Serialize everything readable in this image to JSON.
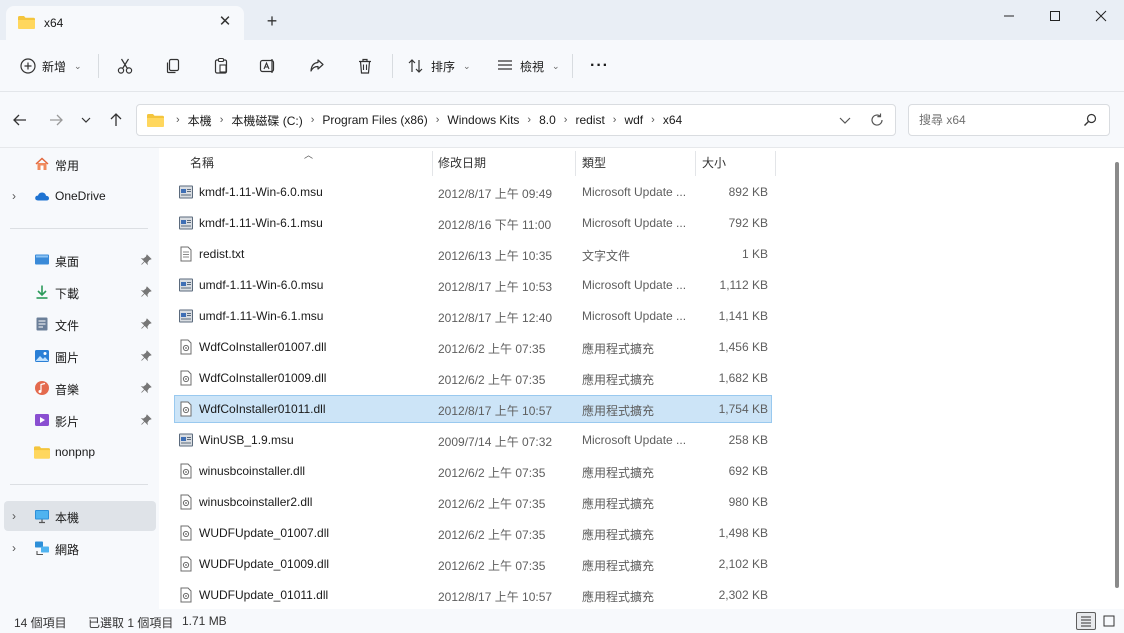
{
  "window": {
    "tab_title": "x64",
    "new_tab_symbol": "+",
    "close_tab_symbol": "✕"
  },
  "toolbar": {
    "new_label": "新增",
    "sort_label": "排序",
    "view_label": "檢視",
    "more_symbol": "···"
  },
  "breadcrumb": [
    "本機",
    "本機磁碟 (C:)",
    "Program Files (x86)",
    "Windows Kits",
    "8.0",
    "redist",
    "wdf",
    "x64"
  ],
  "search": {
    "placeholder": "搜尋 x64"
  },
  "sidebar": {
    "items": [
      {
        "label": "常用",
        "icon": "home-icon",
        "chevron": false,
        "pinned": false
      },
      {
        "label": "OneDrive",
        "icon": "cloud-icon",
        "chevron": true,
        "pinned": false
      },
      {
        "label": "桌面",
        "icon": "desktop-icon",
        "chevron": false,
        "pinned": true
      },
      {
        "label": "下載",
        "icon": "download-icon",
        "chevron": false,
        "pinned": true
      },
      {
        "label": "文件",
        "icon": "document-icon",
        "chevron": false,
        "pinned": true
      },
      {
        "label": "圖片",
        "icon": "picture-icon",
        "chevron": false,
        "pinned": true
      },
      {
        "label": "音樂",
        "icon": "music-icon",
        "chevron": false,
        "pinned": true
      },
      {
        "label": "影片",
        "icon": "video-icon",
        "chevron": false,
        "pinned": true
      },
      {
        "label": "nonpnp",
        "icon": "folder-icon",
        "chevron": false,
        "pinned": false
      },
      {
        "label": "本機",
        "icon": "computer-icon",
        "chevron": true,
        "pinned": false,
        "selected": true
      },
      {
        "label": "網路",
        "icon": "network-icon",
        "chevron": true,
        "pinned": false
      }
    ]
  },
  "columns": {
    "name": "名稱",
    "date": "修改日期",
    "type": "類型",
    "size": "大小"
  },
  "files": [
    {
      "name": "kmdf-1.11-Win-6.0.msu",
      "date": "2012/8/17 上午 09:49",
      "type": "Microsoft Update ...",
      "size": "892 KB",
      "icon": "msu-icon"
    },
    {
      "name": "kmdf-1.11-Win-6.1.msu",
      "date": "2012/8/16 下午 11:00",
      "type": "Microsoft Update ...",
      "size": "792 KB",
      "icon": "msu-icon"
    },
    {
      "name": "redist.txt",
      "date": "2012/6/13 上午 10:35",
      "type": "文字文件",
      "size": "1 KB",
      "icon": "text-file-icon"
    },
    {
      "name": "umdf-1.11-Win-6.0.msu",
      "date": "2012/8/17 上午 10:53",
      "type": "Microsoft Update ...",
      "size": "1,112 KB",
      "icon": "msu-icon"
    },
    {
      "name": "umdf-1.11-Win-6.1.msu",
      "date": "2012/8/17 上午 12:40",
      "type": "Microsoft Update ...",
      "size": "1,141 KB",
      "icon": "msu-icon"
    },
    {
      "name": "WdfCoInstaller01007.dll",
      "date": "2012/6/2 上午 07:35",
      "type": "應用程式擴充",
      "size": "1,456 KB",
      "icon": "dll-icon"
    },
    {
      "name": "WdfCoInstaller01009.dll",
      "date": "2012/6/2 上午 07:35",
      "type": "應用程式擴充",
      "size": "1,682 KB",
      "icon": "dll-icon"
    },
    {
      "name": "WdfCoInstaller01011.dll",
      "date": "2012/8/17 上午 10:57",
      "type": "應用程式擴充",
      "size": "1,754 KB",
      "icon": "dll-icon",
      "selected": true
    },
    {
      "name": "WinUSB_1.9.msu",
      "date": "2009/7/14 上午 07:32",
      "type": "Microsoft Update ...",
      "size": "258 KB",
      "icon": "msu-icon"
    },
    {
      "name": "winusbcoinstaller.dll",
      "date": "2012/6/2 上午 07:35",
      "type": "應用程式擴充",
      "size": "692 KB",
      "icon": "dll-icon"
    },
    {
      "name": "winusbcoinstaller2.dll",
      "date": "2012/6/2 上午 07:35",
      "type": "應用程式擴充",
      "size": "980 KB",
      "icon": "dll-icon"
    },
    {
      "name": "WUDFUpdate_01007.dll",
      "date": "2012/6/2 上午 07:35",
      "type": "應用程式擴充",
      "size": "1,498 KB",
      "icon": "dll-icon"
    },
    {
      "name": "WUDFUpdate_01009.dll",
      "date": "2012/6/2 上午 07:35",
      "type": "應用程式擴充",
      "size": "2,102 KB",
      "icon": "dll-icon"
    },
    {
      "name": "WUDFUpdate_01011.dll",
      "date": "2012/8/17 上午 10:57",
      "type": "應用程式擴充",
      "size": "2,302 KB",
      "icon": "dll-icon"
    }
  ],
  "status": {
    "item_count": "14 個項目",
    "selection": "已選取 1 個項目",
    "selection_size": "1.71 MB"
  }
}
